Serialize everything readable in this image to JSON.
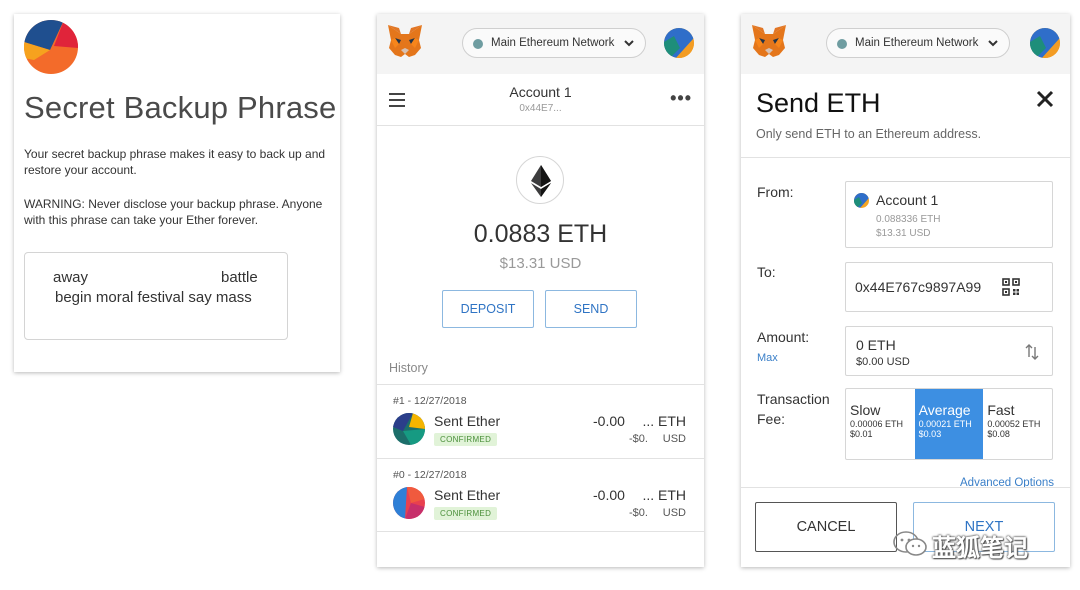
{
  "backup": {
    "title": "Secret Backup Phrase",
    "description": "Your secret backup phrase makes it easy to back up and restore your account.",
    "warning": "WARNING: Never disclose your backup phrase. Anyone with this phrase can take your Ether forever.",
    "phrase_word_1": "away",
    "phrase_word_2": "battle",
    "phrase_line_2": "begin moral festival say mass"
  },
  "header": {
    "network_label": "Main Ethereum Network",
    "icons": [
      "metamask-fox-icon",
      "network-dot-icon",
      "chevron-down-icon",
      "account-avatar-icon"
    ]
  },
  "wallet": {
    "account_name": "Account 1",
    "account_address": "0x44E7...",
    "balance": "0.0883 ETH",
    "balance_usd": "$13.31 USD",
    "deposit_label": "DEPOSIT",
    "send_label": "SEND",
    "history_label": "History",
    "transactions": [
      {
        "date": "#1 - 12/27/2018",
        "title": "Sent Ether",
        "status": "CONFIRMED",
        "amount": "-0.00",
        "amount_unit": "... ETH",
        "usd": "-$0.",
        "usd_unit": "USD"
      },
      {
        "date": "#0 - 12/27/2018",
        "title": "Sent Ether",
        "status": "CONFIRMED",
        "amount": "-0.00",
        "amount_unit": "... ETH",
        "usd": "-$0.",
        "usd_unit": "USD"
      }
    ]
  },
  "send": {
    "title": "Send ETH",
    "subtitle": "Only send ETH to an Ethereum address.",
    "from_label": "From:",
    "from_account": "Account 1",
    "from_eth": "0.088336 ETH",
    "from_usd": "$13.31 USD",
    "to_label": "To:",
    "to_address": "0x44E767c9897A99",
    "amount_label": "Amount:",
    "max_label": "Max",
    "amount_value": "0  ETH",
    "amount_usd": "$0.00 USD",
    "fee_label_1": "Transaction",
    "fee_label_2": "Fee:",
    "fees": [
      {
        "name": "Slow",
        "eth": "0.00006 ETH",
        "usd": "$0.01"
      },
      {
        "name": "Average",
        "eth": "0.00021 ETH",
        "usd": "$0.03"
      },
      {
        "name": "Fast",
        "eth": "0.00052 ETH",
        "usd": "$0.08"
      }
    ],
    "selected_fee": "Average",
    "advanced_label": "Advanced Options",
    "cancel_label": "CANCEL",
    "next_label": "NEXT"
  },
  "watermark": {
    "text": "蓝狐笔记"
  },
  "colors": {
    "accent_blue": "#3d8fe2",
    "link_blue": "#2f74c4",
    "confirmed_green": "#4a8f3a",
    "header_gray": "#f4f4f4"
  }
}
